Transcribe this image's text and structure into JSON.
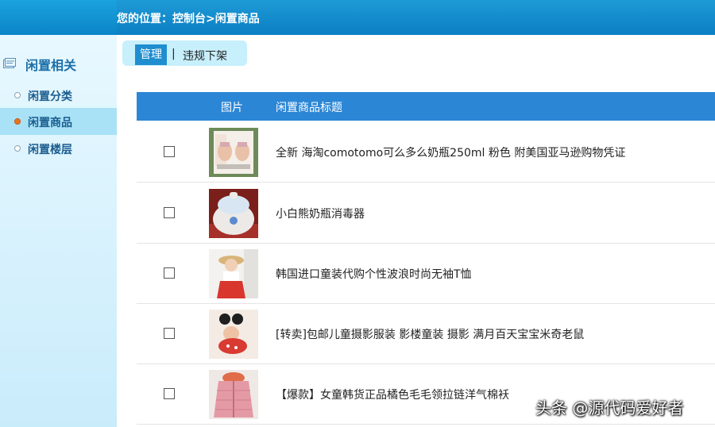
{
  "breadcrumb": "您的位置：控制台>闲置商品",
  "sidebar": {
    "heading": "闲置相关",
    "heading_icon": "window-icon",
    "items": [
      {
        "label": "闲置分类",
        "active": false
      },
      {
        "label": "闲置商品",
        "active": true
      },
      {
        "label": "闲置楼层",
        "active": false
      }
    ]
  },
  "tabs": {
    "active": "管理",
    "separator": "|",
    "other": "违规下架"
  },
  "table": {
    "headers": {
      "image": "图片",
      "title": "闲置商品标题"
    },
    "rows": [
      {
        "title": "全新 海淘comotomo可么多么奶瓶250ml 粉色 附美国亚马逊购物凭证",
        "image": "baby-bottle-box-photo"
      },
      {
        "title": "小白熊奶瓶消毒器",
        "image": "bottle-sterilizer-photo"
      },
      {
        "title": "韩国进口童装代购个性波浪时尚无袖T恤",
        "image": "child-in-sun-hat-photo"
      },
      {
        "title": "[转卖]包邮儿童摄影服装 影楼童装 摄影 满月百天宝宝米奇老鼠",
        "image": "baby-mouse-costume-photo"
      },
      {
        "title": "【爆款】女童韩货正品橘色毛毛领拉链洋气棉袄",
        "image": "pink-padded-jacket-photo"
      }
    ]
  },
  "watermark": "头条 @源代码爱好者",
  "colors": {
    "header_blue": "#0b7fc4",
    "table_header": "#2b86d6",
    "active_tab": "#1f8ed0",
    "sidebar_active": "#a9e2f6",
    "active_dot": "#e8771a"
  }
}
